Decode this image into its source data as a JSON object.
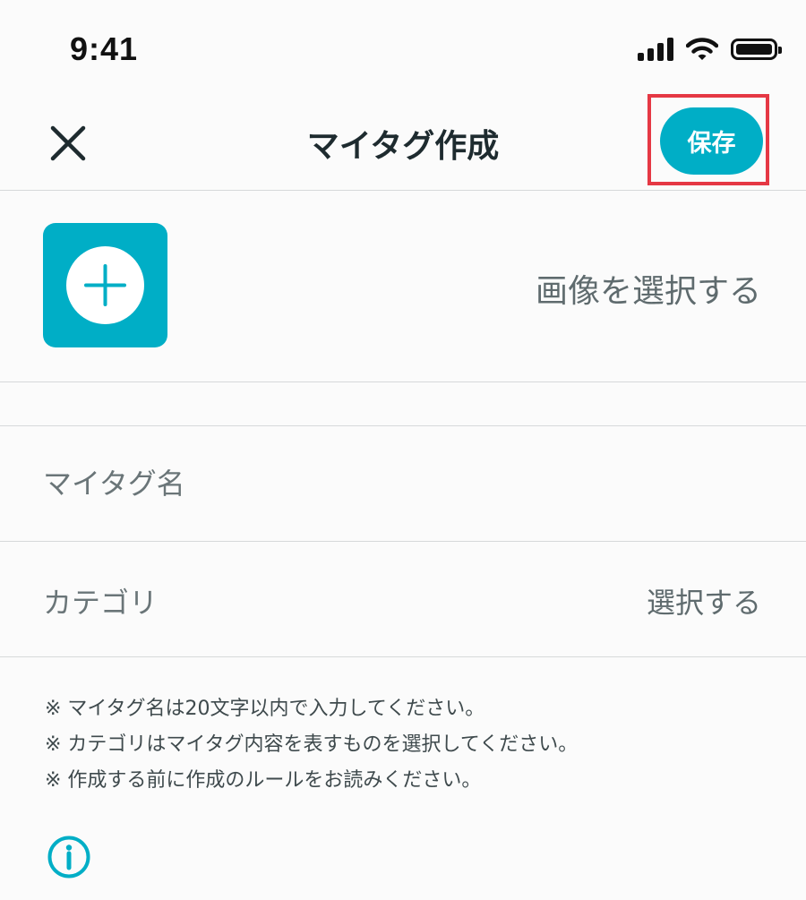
{
  "status_bar": {
    "time": "9:41",
    "icons": [
      "signal-icon",
      "wifi-icon",
      "battery-icon"
    ]
  },
  "header": {
    "title": "マイタグ作成",
    "save_label": "保存",
    "close_icon": "close-icon"
  },
  "image_picker": {
    "icon": "plus-icon",
    "label": "画像を選択する"
  },
  "form": {
    "name_placeholder": "マイタグ名",
    "name_value": "",
    "category_label": "カテゴリ",
    "category_value": "選択する"
  },
  "notes": [
    "※ マイタグ名は20文字以内で入力してください。",
    "※ カテゴリはマイタグ内容を表すものを選択してください。",
    "※ 作成する前に作成のルールをお読みください。"
  ],
  "footer": {
    "info_icon": "info-icon"
  },
  "colors": {
    "accent": "#00aec6",
    "highlight": "#e53844",
    "divider": "#d6d9da",
    "background": "#fbfbfb"
  }
}
